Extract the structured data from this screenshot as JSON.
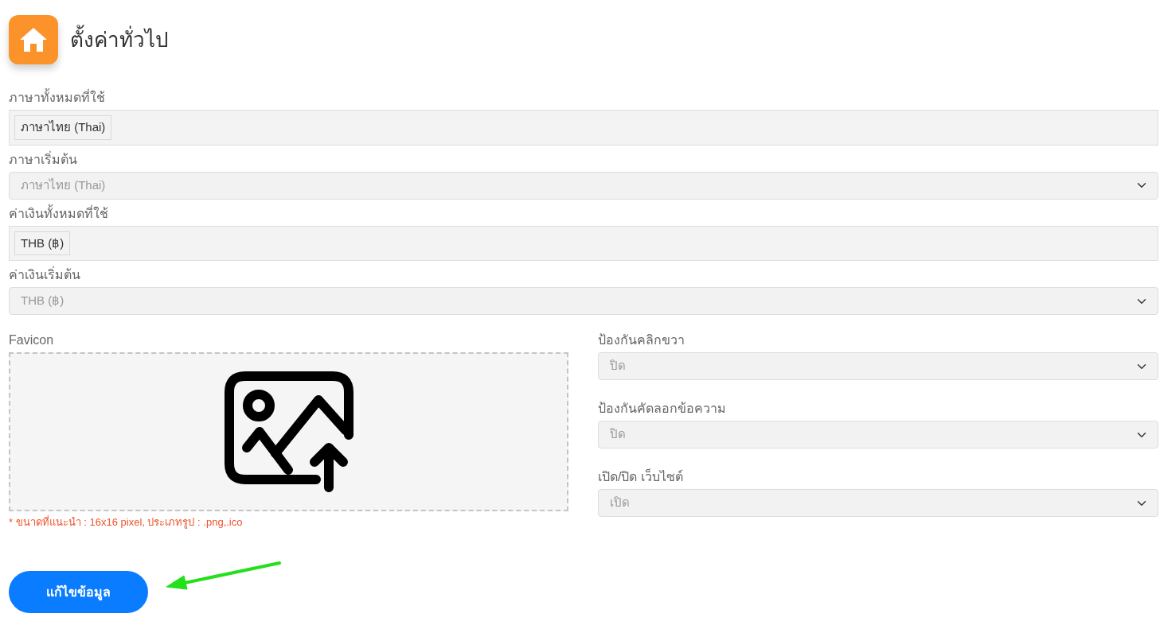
{
  "header": {
    "title": "ตั้งค่าทั่วไป"
  },
  "fields": [
    {
      "kind": "tags",
      "label": "ภาษาทั้งหมดที่ใช้",
      "tags": [
        "ภาษาไทย (Thai)"
      ]
    },
    {
      "kind": "select",
      "label": "ภาษาเริ่มต้น",
      "value": "ภาษาไทย (Thai)",
      "disabled": true
    },
    {
      "kind": "tags",
      "label": "ค่าเงินทั้งหมดที่ใช้",
      "tags": [
        "THB (฿)"
      ]
    },
    {
      "kind": "select",
      "label": "ค่าเงินเริ่มต้น",
      "value": "THB (฿)",
      "disabled": true
    }
  ],
  "favicon": {
    "label": "Favicon",
    "hint": "* ขนาดที่แนะนำ : 16x16 pixel, ประเภทรูป : .png,.ico"
  },
  "side_fields": [
    {
      "kind": "select",
      "label": "ป้องกันคลิกขวา",
      "value": "ปิด",
      "disabled": true
    },
    {
      "kind": "select",
      "label": "ป้องกันคัดลอกข้อความ",
      "value": "ปิด",
      "disabled": true
    },
    {
      "kind": "select",
      "label": "เปิด/ปิด เว็บไซต์",
      "value": "เปิด",
      "disabled": true
    }
  ],
  "submit_button": "แก้ไขข้อมูล"
}
